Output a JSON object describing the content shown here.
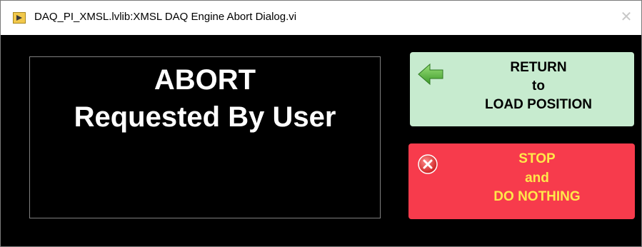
{
  "window": {
    "title": "DAQ_PI_XMSL.lvlib:XMSL DAQ Engine Abort Dialog.vi",
    "app_icon": "labview-vi-icon",
    "close_icon": "close-icon",
    "close_glyph": "✕"
  },
  "message": {
    "line1": "ABORT",
    "line2": "Requested By User"
  },
  "buttons": {
    "return": {
      "icon": "green-left-arrow-icon",
      "line1": "RETURN",
      "line2": "to",
      "line3": "LOAD POSITION",
      "background": "#c7ebcf",
      "text_color": "#000000"
    },
    "stop": {
      "icon": "red-x-circle-icon",
      "line1": "STOP",
      "line2": "and",
      "line3": "DO NOTHING",
      "background": "#f73b4c",
      "text_color": "#ffe84a"
    }
  },
  "colors": {
    "panel_background": "#000000",
    "message_text": "#ffffff"
  }
}
